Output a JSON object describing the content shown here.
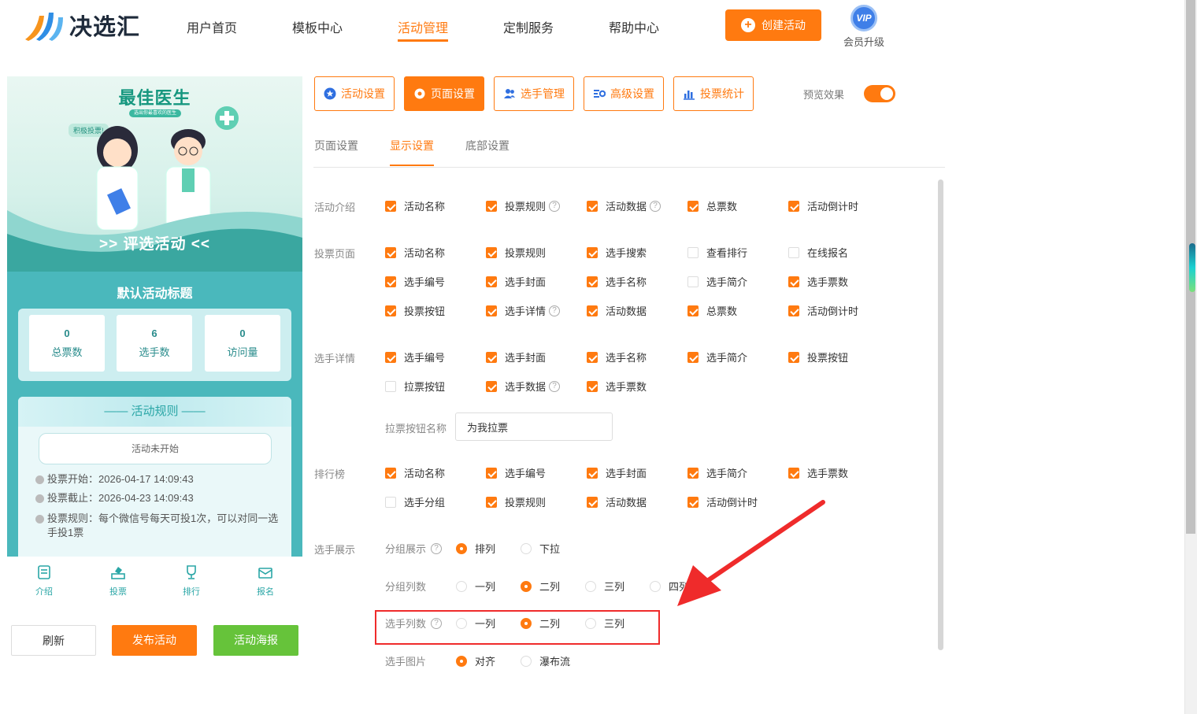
{
  "header": {
    "logo_text": "决选汇",
    "nav": [
      "用户首页",
      "模板中心",
      "活动管理",
      "定制服务",
      "帮助中心"
    ],
    "active_nav": "活动管理",
    "create_button": "创建活动",
    "vip_badge": "VIP",
    "vip_label": "会员升级"
  },
  "preview": {
    "banner_title": "最佳医生",
    "banner_subtitle": "选出你最喜欢的医生",
    "banner_tag": "积极投票!",
    "banner_bar": ">> 评选活动 <<",
    "activity_title": "默认活动标题",
    "stats": [
      {
        "value": "0",
        "label": "总票数"
      },
      {
        "value": "6",
        "label": "选手数"
      },
      {
        "value": "0",
        "label": "访问量"
      }
    ],
    "rules_title": "活动规则",
    "status": "活动未开始",
    "vote_start": "投票开始：2026-04-17 14:09:43",
    "vote_end": "投票截止：2026-04-23 14:09:43",
    "vote_rule": "投票规则：每个微信号每天可投1次，可以对同一选手投1票"
  },
  "bottom_nav": [
    "介绍",
    "投票",
    "排行",
    "报名"
  ],
  "action_buttons": {
    "refresh": "刷新",
    "publish": "发布活动",
    "poster": "活动海报"
  },
  "colors": {
    "accent": "#ff7a10",
    "teal": "#4ab8bc",
    "green": "#66c33a",
    "highlight": "#ef2b2b"
  },
  "top_tabs": [
    "活动设置",
    "页面设置",
    "选手管理",
    "高级设置",
    "投票统计"
  ],
  "active_top_tab": "页面设置",
  "preview_label": "预览效果",
  "preview_on": true,
  "sub_tabs": [
    "页面设置",
    "显示设置",
    "底部设置"
  ],
  "active_sub_tab": "显示设置",
  "sections": {
    "intro": {
      "label": "活动介绍",
      "items": [
        {
          "label": "活动名称",
          "checked": true
        },
        {
          "label": "投票规则",
          "checked": true,
          "help": true
        },
        {
          "label": "活动数据",
          "checked": true,
          "help": true
        },
        {
          "label": "总票数",
          "checked": true
        },
        {
          "label": "活动倒计时",
          "checked": true
        }
      ]
    },
    "vote_page": {
      "label": "投票页面",
      "items": [
        {
          "label": "活动名称",
          "checked": true
        },
        {
          "label": "投票规则",
          "checked": true
        },
        {
          "label": "选手搜索",
          "checked": true
        },
        {
          "label": "查看排行",
          "checked": false
        },
        {
          "label": "在线报名",
          "checked": false
        },
        {
          "label": "选手编号",
          "checked": true
        },
        {
          "label": "选手封面",
          "checked": true
        },
        {
          "label": "选手名称",
          "checked": true
        },
        {
          "label": "选手简介",
          "checked": false
        },
        {
          "label": "选手票数",
          "checked": true
        },
        {
          "label": "投票按钮",
          "checked": true
        },
        {
          "label": "选手详情",
          "checked": true,
          "help": true
        },
        {
          "label": "活动数据",
          "checked": true
        },
        {
          "label": "总票数",
          "checked": true
        },
        {
          "label": "活动倒计时",
          "checked": true
        }
      ]
    },
    "player_detail": {
      "label": "选手详情",
      "items": [
        {
          "label": "选手编号",
          "checked": true
        },
        {
          "label": "选手封面",
          "checked": true
        },
        {
          "label": "选手名称",
          "checked": true
        },
        {
          "label": "选手简介",
          "checked": true
        },
        {
          "label": "投票按钮",
          "checked": true
        },
        {
          "label": "拉票按钮",
          "checked": false
        },
        {
          "label": "选手数据",
          "checked": true,
          "help": true
        },
        {
          "label": "选手票数",
          "checked": true
        }
      ],
      "canvass_label": "拉票按钮名称",
      "canvass_value": "为我拉票"
    },
    "ranking": {
      "label": "排行榜",
      "items": [
        {
          "label": "活动名称",
          "checked": true
        },
        {
          "label": "选手编号",
          "checked": true
        },
        {
          "label": "选手封面",
          "checked": true
        },
        {
          "label": "选手简介",
          "checked": true
        },
        {
          "label": "选手票数",
          "checked": true
        },
        {
          "label": "选手分组",
          "checked": false
        },
        {
          "label": "投票规则",
          "checked": true
        },
        {
          "label": "活动数据",
          "checked": true
        },
        {
          "label": "活动倒计时",
          "checked": true
        }
      ]
    },
    "display": {
      "label": "选手展示",
      "group_display": {
        "label": "分组展示",
        "options": [
          "排列",
          "下拉"
        ],
        "selected": 0
      },
      "group_columns": {
        "label": "分组列数",
        "options": [
          "一列",
          "二列",
          "三列",
          "四列"
        ],
        "selected": 1
      },
      "player_columns": {
        "label": "选手列数",
        "options": [
          "一列",
          "二列",
          "三列"
        ],
        "selected": 1
      },
      "player_image": {
        "label": "选手图片",
        "options": [
          "对齐",
          "瀑布流"
        ],
        "selected": 0
      }
    }
  }
}
